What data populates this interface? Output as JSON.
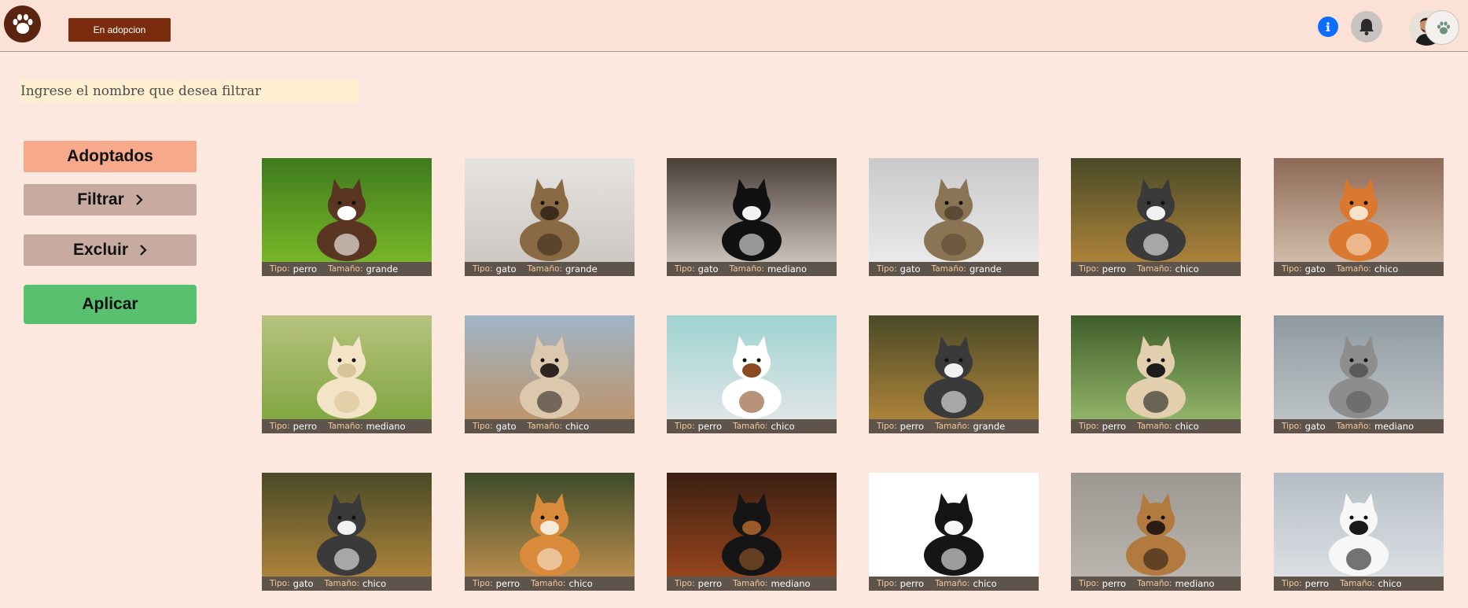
{
  "header": {
    "logo_icon": "paw-icon",
    "nav_button_label": "En adopcion",
    "info_icon": "info-icon",
    "bell_icon": "bell-icon",
    "avatar_icon": "user-avatar"
  },
  "search": {
    "placeholder": "Ingrese el nombre que desea filtrar",
    "value": ""
  },
  "sidebar": {
    "adoptados_label": "Adoptados",
    "filtrar_label": "Filtrar",
    "excluir_label": "Excluir",
    "aplicar_label": "Aplicar"
  },
  "caption_keys": {
    "tipo": "Tipo:",
    "tamano": "Tamaño:"
  },
  "colors": {
    "header": "#fce1d6",
    "background": "#fde8e0",
    "nav_button": "#7a2c0f",
    "adoptados": "#f6a98b",
    "sidebar_button": "#c8aba0",
    "aplicar": "#58c06f",
    "caption_bar": "#5e544c"
  },
  "pets": [
    {
      "tipo": "perro",
      "tamano": "grande",
      "image": "border-collie-running-with-ball-in-grass"
    },
    {
      "tipo": "gato",
      "tamano": "grande",
      "image": "bengal-cat-walking-in-kitchen"
    },
    {
      "tipo": "gato",
      "tamano": "mediano",
      "image": "black-and-white-cat-lying-on-counter"
    },
    {
      "tipo": "gato",
      "tamano": "grande",
      "image": "tabby-cat-sitting-on-bed"
    },
    {
      "tipo": "perro",
      "tamano": "chico",
      "image": "husky-in-autumn-foliage"
    },
    {
      "tipo": "gato",
      "tamano": "chico",
      "image": "orange-cat-sitting-on-floor"
    },
    {
      "tipo": "perro",
      "tamano": "mediano",
      "image": "golden-retriever-sitting-on-grass"
    },
    {
      "tipo": "gato",
      "tamano": "chico",
      "image": "siamese-cat-on-balcony-table"
    },
    {
      "tipo": "perro",
      "tamano": "chico",
      "image": "jack-russell-puppy-standing"
    },
    {
      "tipo": "perro",
      "tamano": "grande",
      "image": "husky-in-autumn-foliage"
    },
    {
      "tipo": "perro",
      "tamano": "chico",
      "image": "pug-on-green-background"
    },
    {
      "tipo": "gato",
      "tamano": "mediano",
      "image": "grey-tabby-cat-outdoors"
    },
    {
      "tipo": "gato",
      "tamano": "chico",
      "image": "husky-in-autumn-foliage"
    },
    {
      "tipo": "perro",
      "tamano": "chico",
      "image": "shiba-inu-in-autumn-leaves"
    },
    {
      "tipo": "perro",
      "tamano": "mediano",
      "image": "rottweiler-puppy-lying-down"
    },
    {
      "tipo": "perro",
      "tamano": "chico",
      "image": "border-collie-puppy-on-white"
    },
    {
      "tipo": "perro",
      "tamano": "mediano",
      "image": "brown-puppy-on-concrete"
    },
    {
      "tipo": "perro",
      "tamano": "chico",
      "image": "dalmatian-portrait"
    }
  ]
}
